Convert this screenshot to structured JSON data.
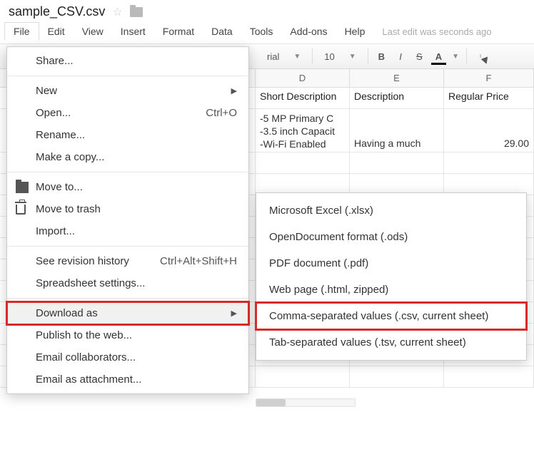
{
  "title": "sample_CSV.csv",
  "menus": {
    "file": "File",
    "edit": "Edit",
    "view": "View",
    "insert": "Insert",
    "format": "Format",
    "data": "Data",
    "tools": "Tools",
    "addons": "Add-ons",
    "help": "Help"
  },
  "last_edit": "Last edit was seconds ago",
  "toolbar": {
    "font_fragment": "rial",
    "font_size": "10",
    "bold": "B",
    "italic": "I",
    "strike": "S",
    "textcolor": "A"
  },
  "columns": {
    "d": "D",
    "e": "E",
    "f": "F"
  },
  "grid": {
    "header": {
      "d": "Short Description",
      "e": "Description",
      "f": "Regular Price"
    },
    "row2": {
      "d": "-5 MP Primary C\n-3.5 inch Capacit\n-Wi-Fi Enabled",
      "e": "Having a much",
      "f": "29.00"
    }
  },
  "file_menu": {
    "share": "Share...",
    "new": "New",
    "open": "Open...",
    "open_shortcut": "Ctrl+O",
    "rename": "Rename...",
    "make_copy": "Make a copy...",
    "move_to": "Move to...",
    "move_trash": "Move to trash",
    "import": "Import...",
    "revision": "See revision history",
    "revision_shortcut": "Ctrl+Alt+Shift+H",
    "settings": "Spreadsheet settings...",
    "download_as": "Download as",
    "publish": "Publish to the web...",
    "email_collab": "Email collaborators...",
    "email_attach": "Email as attachment..."
  },
  "download_submenu": {
    "xlsx": "Microsoft Excel (.xlsx)",
    "ods": "OpenDocument format (.ods)",
    "pdf": "PDF document (.pdf)",
    "html": "Web page (.html, zipped)",
    "csv": "Comma-separated values (.csv, current sheet)",
    "tsv": "Tab-separated values (.tsv, current sheet)"
  }
}
